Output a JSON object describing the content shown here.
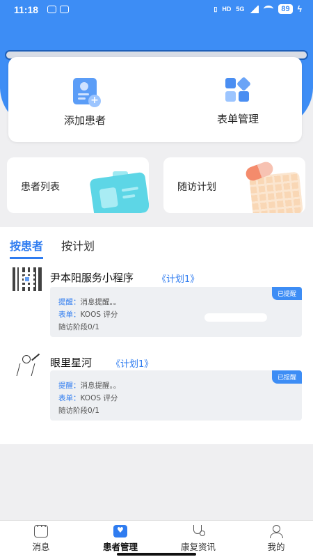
{
  "status_bar": {
    "time": "11:18",
    "network": "5G",
    "hd": "HD",
    "battery": "89"
  },
  "actions": {
    "add_patient": "添加患者",
    "form_manage": "表单管理"
  },
  "shortcuts": {
    "patient_list": "患者列表",
    "followup_plan": "随访计划"
  },
  "tabs": [
    {
      "label": "按患者",
      "active": true
    },
    {
      "label": "按计划",
      "active": false
    }
  ],
  "patients": [
    {
      "name": "尹本阳服务小程序",
      "plan": "《计划1》",
      "badge": "已提醒",
      "reminder_key": "提醒：",
      "reminder_val": "消息提醒。。",
      "form_key": "表单：",
      "form_val": "KOOS 评分",
      "stage": "随访阶段0/1",
      "avatar_icon": "qr-code-icon"
    },
    {
      "name": "眼里星河",
      "plan": "《计划1》",
      "badge": "已提醒",
      "reminder_key": "提醒：",
      "reminder_val": "消息提醒。。",
      "form_key": "表单：",
      "form_val": "KOOS 评分",
      "stage": "随访阶段0/1",
      "avatar_icon": "sketch-avatar-icon"
    }
  ],
  "bottom_nav": [
    {
      "label": "消息",
      "icon": "message-icon",
      "active": false
    },
    {
      "label": "患者管理",
      "icon": "patient-manage-icon",
      "active": true
    },
    {
      "label": "康复资讯",
      "icon": "stethoscope-icon",
      "active": false
    },
    {
      "label": "我的",
      "icon": "profile-icon",
      "active": false
    }
  ],
  "colors": {
    "primary": "#3d8df5",
    "tab_active": "#2f7cf0",
    "background": "#efeff1"
  }
}
